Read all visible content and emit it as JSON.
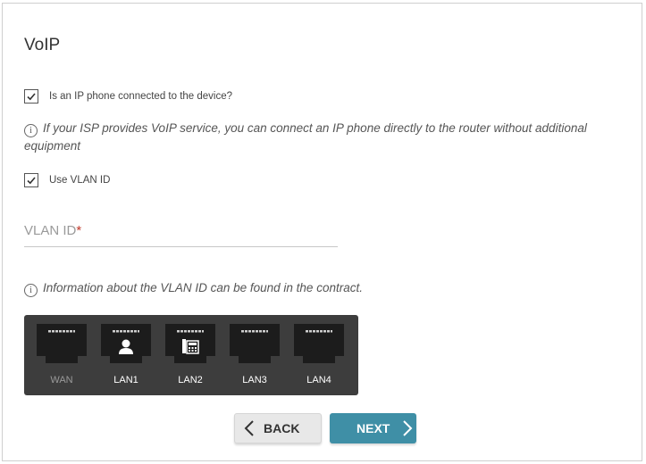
{
  "page": {
    "title": "VoIP"
  },
  "ip_phone": {
    "label": "Is an IP phone connected to the device?",
    "checked": true
  },
  "info1": {
    "text": "If your ISP provides VoIP service, you can connect an IP phone directly to the router without additional equipment"
  },
  "vlan": {
    "label": "Use VLAN ID",
    "checked": true
  },
  "vlan_field": {
    "label": "VLAN ID",
    "required_mark": "*",
    "value": ""
  },
  "info2": {
    "text": "Information about the VLAN ID can be found in the contract."
  },
  "ports": [
    {
      "label": "WAN",
      "glyph": "",
      "icon": "ethernet-port-icon",
      "active": false
    },
    {
      "label": "LAN1",
      "glyph": "user",
      "icon": "user-icon",
      "active": true
    },
    {
      "label": "LAN2",
      "glyph": "phone",
      "icon": "phone-icon",
      "active": true
    },
    {
      "label": "LAN3",
      "glyph": "",
      "icon": "ethernet-port-icon",
      "active": true
    },
    {
      "label": "LAN4",
      "glyph": "",
      "icon": "ethernet-port-icon",
      "active": true
    }
  ],
  "buttons": {
    "back": "BACK",
    "next": "NEXT"
  },
  "colors": {
    "accent": "#3f8fa6",
    "port_panel": "#3d3d3d",
    "required": "#c0392b"
  }
}
